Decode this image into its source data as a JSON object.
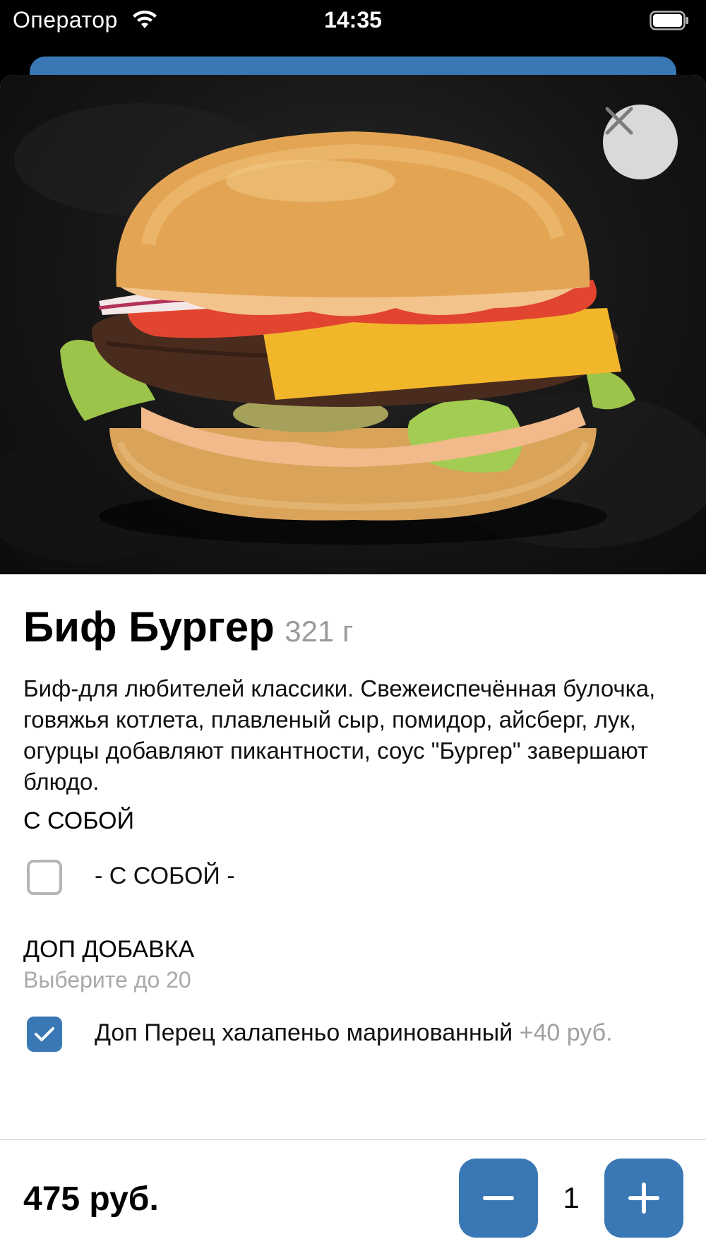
{
  "status_bar": {
    "carrier": "Оператор",
    "time": "14:35"
  },
  "product": {
    "name": "Биф Бургер",
    "weight": "321 г",
    "description": "Биф-для любителей классики. Свежеиспечённая булочка, говяжья котлета, плавленый сыр, помидор, айсберг, лук, огурцы добавляют пикантности, соус \"Бургер\" завершают блюдо."
  },
  "sections": [
    {
      "title": "С СОБОЙ",
      "options": [
        {
          "label": "- С СОБОЙ -",
          "checked": false
        }
      ]
    },
    {
      "title": "ДОП ДОБАВКА",
      "subtitle": "Выберите до 20",
      "options": [
        {
          "label": "Доп Перец халапеньо маринованный",
          "price": "+40 руб.",
          "checked": true
        }
      ]
    }
  ],
  "footer": {
    "total": "475 руб.",
    "quantity": "1"
  },
  "colors": {
    "accent": "#3a78b5",
    "muted_text": "#a0a0a0"
  },
  "icons": [
    "wifi-icon",
    "battery-icon",
    "close-icon",
    "checkmark-icon",
    "minus-icon",
    "plus-icon"
  ]
}
